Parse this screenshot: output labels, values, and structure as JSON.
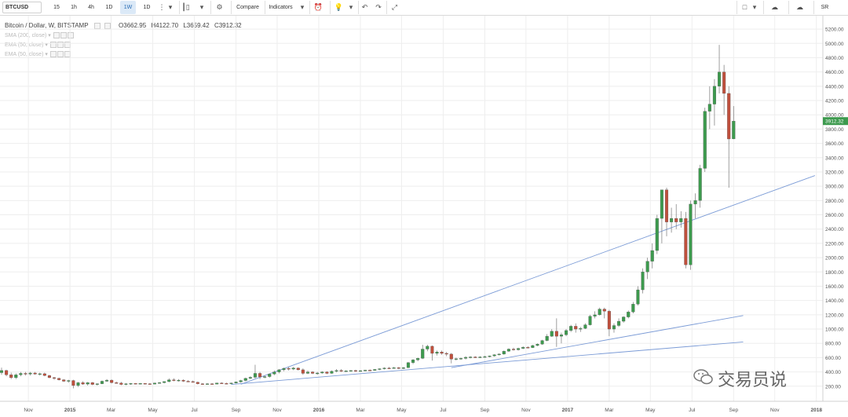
{
  "toolbar": {
    "symbol": "BTCUSD",
    "intervals": [
      "15",
      "1h",
      "4h",
      "1D",
      "1W",
      "1D"
    ],
    "active_interval": "1W",
    "compare_label": "Compare",
    "indicators_label": "Indicators",
    "right_label": "SR"
  },
  "header": {
    "title": "Bitcoin / Dollar, W, BITSTAMP",
    "open": "O3662.95",
    "high": "H4122.70",
    "low": "L3659.42",
    "close": "C3912.32"
  },
  "indicators": [
    "SMA (200, close)",
    "EMA (50, close)",
    "EMA (50, close)"
  ],
  "watermark": "交易员说",
  "colors": {
    "up": "#3d9a4e",
    "down": "#c0503d",
    "grid": "#eeeeee",
    "trend": "#7b9bd6",
    "price_tag": "#3d9a4e"
  },
  "chart_data": {
    "type": "candlestick",
    "title": "Bitcoin / Dollar, W, BITSTAMP",
    "last_price": "3912.32",
    "ylim": [
      0,
      5300
    ],
    "y_ticks": [
      "200.00",
      "400.00",
      "600.00",
      "800.00",
      "1000.00",
      "1200.00",
      "1400.00",
      "1600.00",
      "1800.00",
      "2000.00",
      "2200.00",
      "2400.00",
      "2600.00",
      "2800.00",
      "3000.00",
      "3200.00",
      "3400.00",
      "3600.00",
      "3800.00",
      "4000.00",
      "4200.00",
      "4400.00",
      "4600.00",
      "4800.00",
      "5000.00",
      "5200.00"
    ],
    "x_ticks": [
      "Nov",
      "2015",
      "Mar",
      "May",
      "Jul",
      "Sep",
      "Nov",
      "2016",
      "Mar",
      "May",
      "Jul",
      "Sep",
      "Nov",
      "2017",
      "Mar",
      "May",
      "Jul",
      "Sep",
      "Nov",
      "2018"
    ],
    "x_tick_weeks": [
      -4.4,
      4.3,
      12.9,
      21.6,
      30.3,
      39.0,
      47.6,
      56.3,
      65.0,
      73.6,
      82.3,
      91.0,
      99.6,
      108.3,
      117.0,
      125.6,
      134.3,
      143.0,
      151.6,
      160.3
    ],
    "week_range": [
      -10,
      161
    ],
    "candles": [
      {
        "w": -10,
        "o": 390,
        "h": 460,
        "l": 360,
        "c": 420
      },
      {
        "w": -9,
        "o": 420,
        "h": 430,
        "l": 340,
        "c": 360
      },
      {
        "w": -8,
        "o": 360,
        "h": 390,
        "l": 300,
        "c": 320
      },
      {
        "w": -7,
        "o": 320,
        "h": 380,
        "l": 300,
        "c": 360
      },
      {
        "w": -6,
        "o": 360,
        "h": 400,
        "l": 340,
        "c": 380
      },
      {
        "w": -5,
        "o": 380,
        "h": 400,
        "l": 350,
        "c": 370
      },
      {
        "w": -4,
        "o": 370,
        "h": 400,
        "l": 350,
        "c": 385
      },
      {
        "w": -3,
        "o": 385,
        "h": 400,
        "l": 360,
        "c": 370
      },
      {
        "w": -2,
        "o": 370,
        "h": 390,
        "l": 350,
        "c": 375
      },
      {
        "w": -1,
        "o": 375,
        "h": 390,
        "l": 340,
        "c": 350
      },
      {
        "w": 0,
        "o": 350,
        "h": 360,
        "l": 310,
        "c": 320
      },
      {
        "w": 1,
        "o": 320,
        "h": 330,
        "l": 290,
        "c": 310
      },
      {
        "w": 2,
        "o": 310,
        "h": 320,
        "l": 280,
        "c": 290
      },
      {
        "w": 3,
        "o": 290,
        "h": 300,
        "l": 260,
        "c": 270
      },
      {
        "w": 4,
        "o": 270,
        "h": 290,
        "l": 250,
        "c": 280
      },
      {
        "w": 5,
        "o": 280,
        "h": 290,
        "l": 170,
        "c": 210
      },
      {
        "w": 6,
        "o": 210,
        "h": 260,
        "l": 190,
        "c": 250
      },
      {
        "w": 7,
        "o": 250,
        "h": 270,
        "l": 220,
        "c": 230
      },
      {
        "w": 8,
        "o": 230,
        "h": 260,
        "l": 210,
        "c": 250
      },
      {
        "w": 9,
        "o": 250,
        "h": 260,
        "l": 215,
        "c": 225
      },
      {
        "w": 10,
        "o": 225,
        "h": 240,
        "l": 210,
        "c": 235
      },
      {
        "w": 11,
        "o": 235,
        "h": 280,
        "l": 230,
        "c": 270
      },
      {
        "w": 12,
        "o": 270,
        "h": 300,
        "l": 260,
        "c": 285
      },
      {
        "w": 13,
        "o": 285,
        "h": 295,
        "l": 240,
        "c": 250
      },
      {
        "w": 14,
        "o": 250,
        "h": 265,
        "l": 235,
        "c": 245
      },
      {
        "w": 15,
        "o": 245,
        "h": 260,
        "l": 215,
        "c": 225
      },
      {
        "w": 16,
        "o": 225,
        "h": 245,
        "l": 215,
        "c": 235
      },
      {
        "w": 17,
        "o": 235,
        "h": 245,
        "l": 220,
        "c": 240
      },
      {
        "w": 18,
        "o": 240,
        "h": 245,
        "l": 225,
        "c": 230
      },
      {
        "w": 19,
        "o": 230,
        "h": 245,
        "l": 225,
        "c": 240
      },
      {
        "w": 20,
        "o": 240,
        "h": 245,
        "l": 225,
        "c": 235
      },
      {
        "w": 21,
        "o": 235,
        "h": 245,
        "l": 225,
        "c": 230
      },
      {
        "w": 22,
        "o": 230,
        "h": 250,
        "l": 225,
        "c": 245
      },
      {
        "w": 23,
        "o": 245,
        "h": 260,
        "l": 235,
        "c": 250
      },
      {
        "w": 24,
        "o": 250,
        "h": 270,
        "l": 240,
        "c": 265
      },
      {
        "w": 25,
        "o": 265,
        "h": 310,
        "l": 255,
        "c": 290
      },
      {
        "w": 26,
        "o": 290,
        "h": 310,
        "l": 270,
        "c": 280
      },
      {
        "w": 27,
        "o": 280,
        "h": 300,
        "l": 265,
        "c": 285
      },
      {
        "w": 28,
        "o": 285,
        "h": 295,
        "l": 260,
        "c": 270
      },
      {
        "w": 29,
        "o": 270,
        "h": 285,
        "l": 260,
        "c": 265
      },
      {
        "w": 30,
        "o": 265,
        "h": 280,
        "l": 250,
        "c": 255
      },
      {
        "w": 31,
        "o": 255,
        "h": 265,
        "l": 225,
        "c": 235
      },
      {
        "w": 32,
        "o": 235,
        "h": 245,
        "l": 220,
        "c": 230
      },
      {
        "w": 33,
        "o": 230,
        "h": 245,
        "l": 225,
        "c": 235
      },
      {
        "w": 34,
        "o": 235,
        "h": 245,
        "l": 225,
        "c": 230
      },
      {
        "w": 35,
        "o": 230,
        "h": 250,
        "l": 225,
        "c": 245
      },
      {
        "w": 36,
        "o": 245,
        "h": 255,
        "l": 235,
        "c": 240
      },
      {
        "w": 37,
        "o": 240,
        "h": 250,
        "l": 230,
        "c": 238
      },
      {
        "w": 38,
        "o": 238,
        "h": 250,
        "l": 230,
        "c": 245
      },
      {
        "w": 39,
        "o": 245,
        "h": 265,
        "l": 240,
        "c": 260
      },
      {
        "w": 40,
        "o": 260,
        "h": 290,
        "l": 250,
        "c": 280
      },
      {
        "w": 41,
        "o": 280,
        "h": 320,
        "l": 270,
        "c": 310
      },
      {
        "w": 42,
        "o": 310,
        "h": 340,
        "l": 300,
        "c": 325
      },
      {
        "w": 43,
        "o": 325,
        "h": 500,
        "l": 310,
        "c": 380
      },
      {
        "w": 44,
        "o": 380,
        "h": 400,
        "l": 300,
        "c": 330
      },
      {
        "w": 45,
        "o": 330,
        "h": 350,
        "l": 310,
        "c": 335
      },
      {
        "w": 46,
        "o": 335,
        "h": 380,
        "l": 320,
        "c": 370
      },
      {
        "w": 47,
        "o": 370,
        "h": 420,
        "l": 355,
        "c": 400
      },
      {
        "w": 48,
        "o": 400,
        "h": 440,
        "l": 380,
        "c": 430
      },
      {
        "w": 49,
        "o": 430,
        "h": 460,
        "l": 410,
        "c": 450
      },
      {
        "w": 50,
        "o": 450,
        "h": 470,
        "l": 420,
        "c": 440
      },
      {
        "w": 51,
        "o": 440,
        "h": 470,
        "l": 425,
        "c": 455
      },
      {
        "w": 52,
        "o": 455,
        "h": 465,
        "l": 420,
        "c": 430
      },
      {
        "w": 53,
        "o": 430,
        "h": 450,
        "l": 360,
        "c": 380
      },
      {
        "w": 54,
        "o": 380,
        "h": 420,
        "l": 370,
        "c": 400
      },
      {
        "w": 55,
        "o": 400,
        "h": 410,
        "l": 370,
        "c": 380
      },
      {
        "w": 56,
        "o": 380,
        "h": 400,
        "l": 360,
        "c": 385
      },
      {
        "w": 57,
        "o": 385,
        "h": 410,
        "l": 375,
        "c": 400
      },
      {
        "w": 58,
        "o": 400,
        "h": 410,
        "l": 370,
        "c": 380
      },
      {
        "w": 59,
        "o": 380,
        "h": 420,
        "l": 375,
        "c": 410
      },
      {
        "w": 60,
        "o": 410,
        "h": 440,
        "l": 395,
        "c": 420
      },
      {
        "w": 61,
        "o": 420,
        "h": 440,
        "l": 400,
        "c": 410
      },
      {
        "w": 62,
        "o": 410,
        "h": 425,
        "l": 400,
        "c": 415
      },
      {
        "w": 63,
        "o": 415,
        "h": 425,
        "l": 405,
        "c": 420
      },
      {
        "w": 64,
        "o": 420,
        "h": 430,
        "l": 400,
        "c": 410
      },
      {
        "w": 65,
        "o": 410,
        "h": 425,
        "l": 405,
        "c": 418
      },
      {
        "w": 66,
        "o": 418,
        "h": 430,
        "l": 410,
        "c": 425
      },
      {
        "w": 67,
        "o": 425,
        "h": 435,
        "l": 415,
        "c": 422
      },
      {
        "w": 68,
        "o": 422,
        "h": 440,
        "l": 418,
        "c": 435
      },
      {
        "w": 69,
        "o": 435,
        "h": 450,
        "l": 425,
        "c": 445
      },
      {
        "w": 70,
        "o": 445,
        "h": 465,
        "l": 435,
        "c": 455
      },
      {
        "w": 71,
        "o": 455,
        "h": 470,
        "l": 440,
        "c": 450
      },
      {
        "w": 72,
        "o": 450,
        "h": 470,
        "l": 445,
        "c": 460
      },
      {
        "w": 73,
        "o": 460,
        "h": 470,
        "l": 440,
        "c": 450
      },
      {
        "w": 74,
        "o": 450,
        "h": 470,
        "l": 440,
        "c": 460
      },
      {
        "w": 75,
        "o": 460,
        "h": 540,
        "l": 455,
        "c": 530
      },
      {
        "w": 76,
        "o": 530,
        "h": 580,
        "l": 510,
        "c": 570
      },
      {
        "w": 77,
        "o": 570,
        "h": 600,
        "l": 550,
        "c": 590
      },
      {
        "w": 78,
        "o": 590,
        "h": 780,
        "l": 580,
        "c": 720
      },
      {
        "w": 79,
        "o": 720,
        "h": 780,
        "l": 690,
        "c": 760
      },
      {
        "w": 80,
        "o": 760,
        "h": 770,
        "l": 560,
        "c": 660
      },
      {
        "w": 81,
        "o": 660,
        "h": 700,
        "l": 630,
        "c": 680
      },
      {
        "w": 82,
        "o": 680,
        "h": 700,
        "l": 640,
        "c": 660
      },
      {
        "w": 83,
        "o": 660,
        "h": 680,
        "l": 620,
        "c": 650
      },
      {
        "w": 84,
        "o": 650,
        "h": 665,
        "l": 520,
        "c": 580
      },
      {
        "w": 85,
        "o": 580,
        "h": 600,
        "l": 560,
        "c": 585
      },
      {
        "w": 86,
        "o": 585,
        "h": 600,
        "l": 570,
        "c": 590
      },
      {
        "w": 87,
        "o": 590,
        "h": 620,
        "l": 575,
        "c": 605
      },
      {
        "w": 88,
        "o": 605,
        "h": 620,
        "l": 590,
        "c": 610
      },
      {
        "w": 89,
        "o": 610,
        "h": 620,
        "l": 595,
        "c": 605
      },
      {
        "w": 90,
        "o": 605,
        "h": 620,
        "l": 595,
        "c": 610
      },
      {
        "w": 91,
        "o": 610,
        "h": 625,
        "l": 600,
        "c": 615
      },
      {
        "w": 92,
        "o": 615,
        "h": 630,
        "l": 605,
        "c": 625
      },
      {
        "w": 93,
        "o": 625,
        "h": 650,
        "l": 615,
        "c": 640
      },
      {
        "w": 94,
        "o": 640,
        "h": 660,
        "l": 630,
        "c": 650
      },
      {
        "w": 95,
        "o": 650,
        "h": 700,
        "l": 640,
        "c": 690
      },
      {
        "w": 96,
        "o": 690,
        "h": 730,
        "l": 680,
        "c": 720
      },
      {
        "w": 97,
        "o": 720,
        "h": 740,
        "l": 700,
        "c": 710
      },
      {
        "w": 98,
        "o": 710,
        "h": 740,
        "l": 700,
        "c": 730
      },
      {
        "w": 99,
        "o": 730,
        "h": 760,
        "l": 720,
        "c": 745
      },
      {
        "w": 100,
        "o": 745,
        "h": 760,
        "l": 730,
        "c": 740
      },
      {
        "w": 101,
        "o": 740,
        "h": 780,
        "l": 735,
        "c": 770
      },
      {
        "w": 102,
        "o": 770,
        "h": 800,
        "l": 760,
        "c": 790
      },
      {
        "w": 103,
        "o": 790,
        "h": 850,
        "l": 780,
        "c": 840
      },
      {
        "w": 104,
        "o": 840,
        "h": 930,
        "l": 830,
        "c": 900
      },
      {
        "w": 105,
        "o": 900,
        "h": 1000,
        "l": 890,
        "c": 970
      },
      {
        "w": 106,
        "o": 970,
        "h": 1150,
        "l": 750,
        "c": 900
      },
      {
        "w": 107,
        "o": 900,
        "h": 950,
        "l": 800,
        "c": 920
      },
      {
        "w": 108,
        "o": 920,
        "h": 1000,
        "l": 900,
        "c": 980
      },
      {
        "w": 109,
        "o": 980,
        "h": 1060,
        "l": 960,
        "c": 1040
      },
      {
        "w": 110,
        "o": 1040,
        "h": 1080,
        "l": 950,
        "c": 1000
      },
      {
        "w": 111,
        "o": 1000,
        "h": 1030,
        "l": 960,
        "c": 1010
      },
      {
        "w": 112,
        "o": 1010,
        "h": 1080,
        "l": 1000,
        "c": 1060
      },
      {
        "w": 113,
        "o": 1060,
        "h": 1200,
        "l": 1050,
        "c": 1180
      },
      {
        "w": 114,
        "o": 1180,
        "h": 1250,
        "l": 1150,
        "c": 1200
      },
      {
        "w": 115,
        "o": 1200,
        "h": 1300,
        "l": 1190,
        "c": 1280
      },
      {
        "w": 116,
        "o": 1280,
        "h": 1300,
        "l": 1150,
        "c": 1250
      },
      {
        "w": 117,
        "o": 1250,
        "h": 1270,
        "l": 900,
        "c": 1000
      },
      {
        "w": 118,
        "o": 1000,
        "h": 1080,
        "l": 950,
        "c": 1050
      },
      {
        "w": 119,
        "o": 1050,
        "h": 1150,
        "l": 1030,
        "c": 1110
      },
      {
        "w": 120,
        "o": 1110,
        "h": 1180,
        "l": 1090,
        "c": 1170
      },
      {
        "w": 121,
        "o": 1170,
        "h": 1260,
        "l": 1150,
        "c": 1240
      },
      {
        "w": 122,
        "o": 1240,
        "h": 1380,
        "l": 1220,
        "c": 1350
      },
      {
        "w": 123,
        "o": 1350,
        "h": 1600,
        "l": 1330,
        "c": 1550
      },
      {
        "w": 124,
        "o": 1550,
        "h": 1850,
        "l": 1500,
        "c": 1800
      },
      {
        "w": 125,
        "o": 1800,
        "h": 2000,
        "l": 1700,
        "c": 1950
      },
      {
        "w": 126,
        "o": 1950,
        "h": 2200,
        "l": 1850,
        "c": 2100
      },
      {
        "w": 127,
        "o": 2100,
        "h": 2600,
        "l": 2050,
        "c": 2550
      },
      {
        "w": 128,
        "o": 2550,
        "h": 2800,
        "l": 2200,
        "c": 2950
      },
      {
        "w": 129,
        "o": 2950,
        "h": 2980,
        "l": 2300,
        "c": 2500
      },
      {
        "w": 130,
        "o": 2500,
        "h": 2700,
        "l": 2350,
        "c": 2550
      },
      {
        "w": 131,
        "o": 2550,
        "h": 2750,
        "l": 2400,
        "c": 2500
      },
      {
        "w": 132,
        "o": 2500,
        "h": 2650,
        "l": 2420,
        "c": 2550
      },
      {
        "w": 133,
        "o": 2550,
        "h": 2640,
        "l": 1850,
        "c": 1900
      },
      {
        "w": 134,
        "o": 1900,
        "h": 2800,
        "l": 1830,
        "c": 2750
      },
      {
        "w": 135,
        "o": 2750,
        "h": 2900,
        "l": 2550,
        "c": 2800
      },
      {
        "w": 136,
        "o": 2800,
        "h": 3300,
        "l": 2700,
        "c": 3250
      },
      {
        "w": 137,
        "o": 3250,
        "h": 4100,
        "l": 3200,
        "c": 4050
      },
      {
        "w": 138,
        "o": 4050,
        "h": 4400,
        "l": 3800,
        "c": 4150
      },
      {
        "w": 139,
        "o": 4150,
        "h": 4500,
        "l": 3850,
        "c": 4400
      },
      {
        "w": 140,
        "o": 4400,
        "h": 4980,
        "l": 4300,
        "c": 4600
      },
      {
        "w": 141,
        "o": 4600,
        "h": 4700,
        "l": 4000,
        "c": 4300
      },
      {
        "w": 142,
        "o": 4300,
        "h": 4400,
        "l": 2980,
        "c": 3662
      },
      {
        "w": 143,
        "o": 3662.95,
        "h": 4122.7,
        "l": 3659.42,
        "c": 3912.32
      }
    ],
    "trendlines": [
      {
        "x1": 40,
        "y1": 228,
        "x2": 160,
        "y2": 3150
      },
      {
        "x1": 84,
        "y1": 460,
        "x2": 145,
        "y2": 1190
      },
      {
        "x1": 38,
        "y1": 225,
        "x2": 145,
        "y2": 820
      }
    ]
  }
}
